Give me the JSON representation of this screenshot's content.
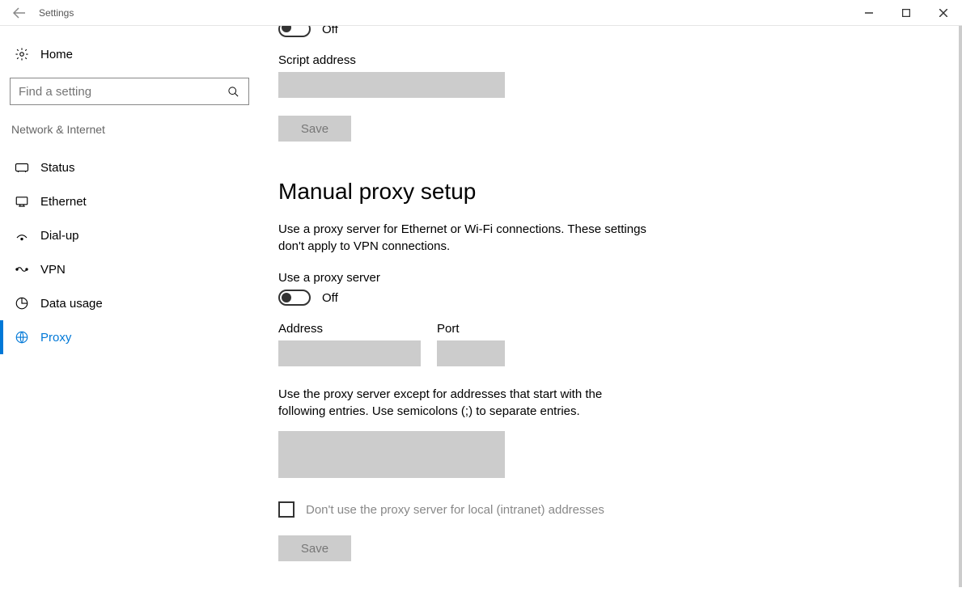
{
  "window": {
    "title": "Settings"
  },
  "sidebar": {
    "home": "Home",
    "search_placeholder": "Find a setting",
    "section": "Network & Internet",
    "items": [
      {
        "label": "Status"
      },
      {
        "label": "Ethernet"
      },
      {
        "label": "Dial-up"
      },
      {
        "label": "VPN"
      },
      {
        "label": "Data usage"
      },
      {
        "label": "Proxy"
      }
    ]
  },
  "auto": {
    "toggle_state": "Off",
    "script_label": "Script address",
    "save": "Save"
  },
  "manual": {
    "heading": "Manual proxy setup",
    "desc": "Use a proxy server for Ethernet or Wi-Fi connections. These settings don't apply to VPN connections.",
    "use_label": "Use a proxy server",
    "toggle_state": "Off",
    "address_label": "Address",
    "port_label": "Port",
    "except_desc": "Use the proxy server except for addresses that start with the following entries. Use semicolons (;) to separate entries.",
    "local_label": "Don't use the proxy server for local (intranet) addresses",
    "save": "Save"
  }
}
